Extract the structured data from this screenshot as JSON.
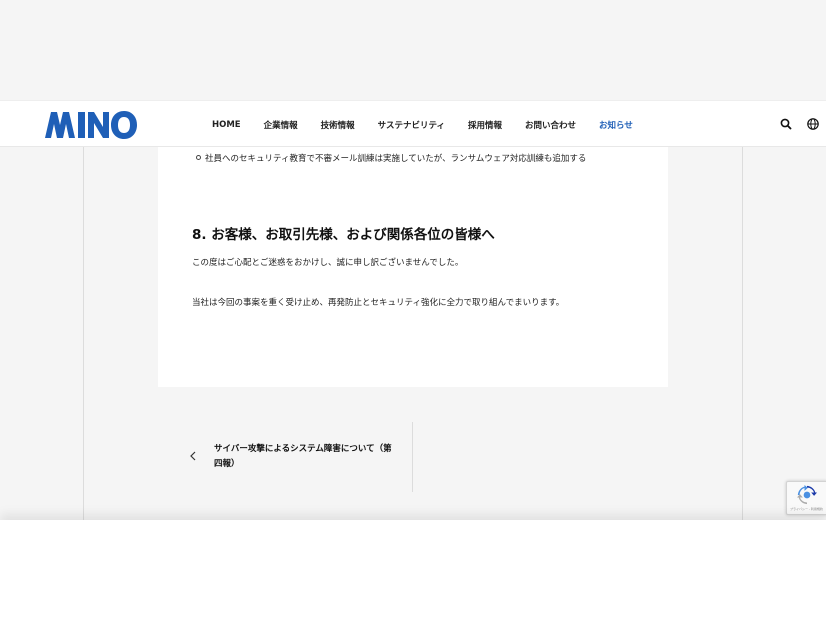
{
  "brand": {
    "logo_text": "MINO",
    "color": "#1f5fb7"
  },
  "nav": {
    "items": [
      {
        "label": "HOME"
      },
      {
        "label": "企業情報"
      },
      {
        "label": "技術情報"
      },
      {
        "label": "サステナビリティ"
      },
      {
        "label": "採用情報"
      },
      {
        "label": "お問い合わせ"
      },
      {
        "label": "お知らせ"
      }
    ],
    "active_index": 6,
    "icons": [
      "search-icon",
      "globe-icon"
    ]
  },
  "article": {
    "bullet": "社員へのセキュリティ教育で不審メール訓練は実施していたが、ランサムウェア対応訓練も追加する",
    "section_heading": "8. お客様、お取引先様、および関係各位の皆様へ",
    "paragraphs": [
      "この度はご心配とご迷惑をおかけし、誠に申し訳ございませんでした。",
      "当社は今回の事案を重く受け止め、再発防止とセキュリティ強化に全力で取り組んでまいります。"
    ]
  },
  "post_nav": {
    "previous_title": "サイバー攻撃によるシステム障害について（第四報）"
  },
  "recaptcha": {
    "text": "プライバシー - 利用規約"
  }
}
